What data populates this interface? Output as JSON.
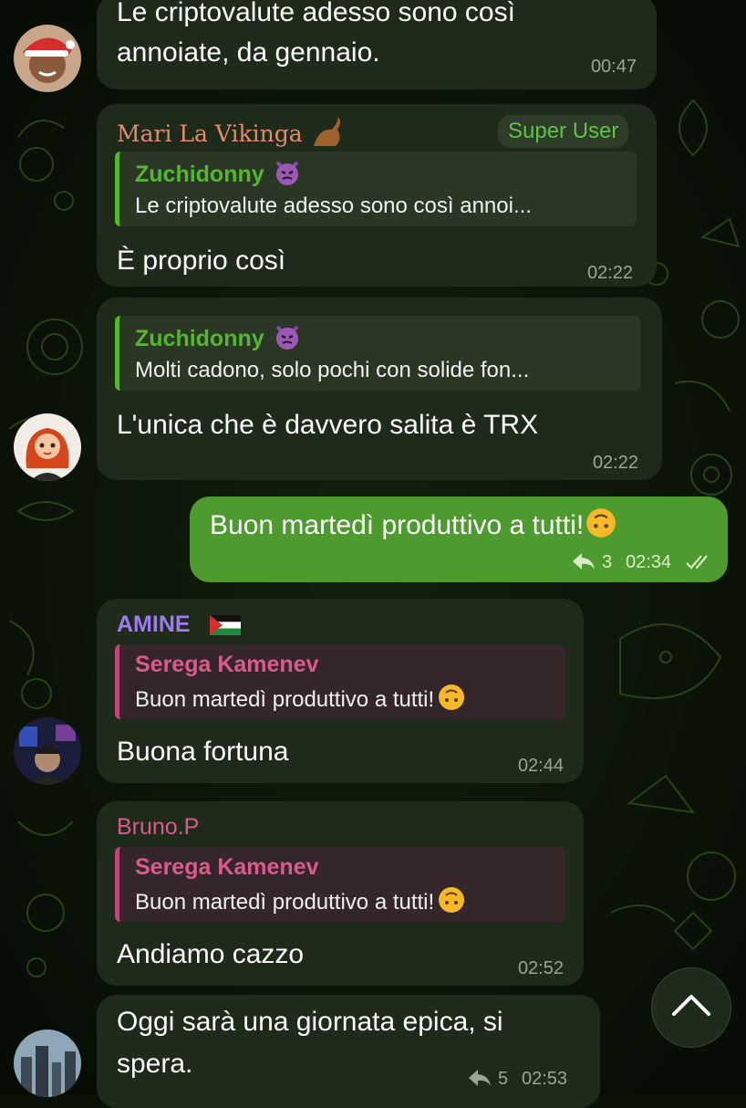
{
  "messages": {
    "m1": {
      "text_line1": "Le criptovalute adesso sono così",
      "text_line2": "annoiate, da gennaio.",
      "time": "00:47"
    },
    "m2": {
      "sender": "Mari La Vikinga",
      "badge": "Super User",
      "reply_name": "Zuchidonny",
      "reply_text": "Le criptovalute adesso sono così annoi...",
      "text": "È proprio così",
      "time": "02:22"
    },
    "m3": {
      "reply_name": "Zuchidonny",
      "reply_text": "Molti cadono, solo pochi con solide fon...",
      "text": "L'unica che è davvero salita è TRX",
      "time": "02:22"
    },
    "m4": {
      "text": "Buon martedì produttivo a tutti!",
      "replies": "3",
      "time": "02:34"
    },
    "m5": {
      "sender": "AMINE",
      "reply_name": "Serega Kamenev",
      "reply_text": "Buon martedì produttivo a tutti!",
      "text": "Buona fortuna",
      "time": "02:44"
    },
    "m6": {
      "sender": "Bruno.P",
      "reply_name": "Serega Kamenev",
      "reply_text": "Buon martedì produttivo a tutti!",
      "text": "Andiamo cazzo",
      "time": "02:52"
    },
    "m7": {
      "text_line1": "Oggi sarà una giornata epica, si",
      "text_line2": "spera.",
      "replies": "5",
      "time": "02:53"
    }
  },
  "colors": {
    "background": "#0b1208",
    "incoming_bubble": "#1e2a1a",
    "outgoing_bubble": "#4d9a2e",
    "reply_green": "#55b72e",
    "reply_pink": "#c2457b",
    "sender_mari": "#e58b6d",
    "sender_amine": "#9d7bf0",
    "sender_bruno": "#d95b8e"
  },
  "icons": [
    "santa-avatar",
    "redhead-avatar",
    "amine-avatar",
    "city-avatar",
    "devil-emoji",
    "upside-down-emoji",
    "palestine-flag",
    "seal-emoji",
    "forward-reply-icon",
    "double-check-icon",
    "chevron-up-icon"
  ]
}
